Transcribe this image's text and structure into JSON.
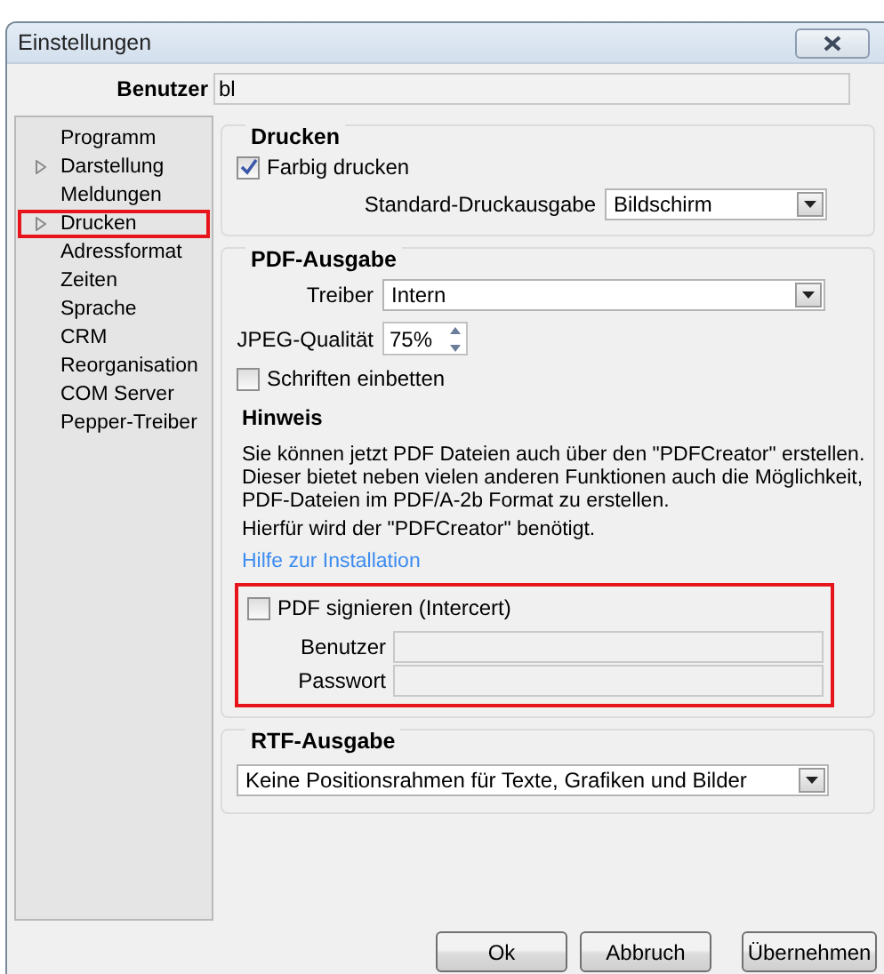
{
  "window": {
    "title": "Einstellungen"
  },
  "user": {
    "label": "Benutzer",
    "value": "bl"
  },
  "sidebar": {
    "items": [
      {
        "label": "Programm",
        "expandable": false,
        "selected": false
      },
      {
        "label": "Darstellung",
        "expandable": true,
        "selected": false
      },
      {
        "label": "Meldungen",
        "expandable": false,
        "selected": false
      },
      {
        "label": "Drucken",
        "expandable": true,
        "selected": true
      },
      {
        "label": "Adressformat",
        "expandable": false,
        "selected": false
      },
      {
        "label": "Zeiten",
        "expandable": false,
        "selected": false
      },
      {
        "label": "Sprache",
        "expandable": false,
        "selected": false
      },
      {
        "label": "CRM",
        "expandable": false,
        "selected": false
      },
      {
        "label": "Reorganisation",
        "expandable": false,
        "selected": false
      },
      {
        "label": "COM Server",
        "expandable": false,
        "selected": false
      },
      {
        "label": "Pepper-Treiber",
        "expandable": false,
        "selected": false
      }
    ]
  },
  "printing": {
    "title": "Drucken",
    "color_print": {
      "label": "Farbig drucken",
      "checked": true
    },
    "default_output": {
      "label": "Standard-Druckausgabe",
      "value": "Bildschirm"
    }
  },
  "pdf": {
    "title": "PDF-Ausgabe",
    "driver": {
      "label": "Treiber",
      "value": "Intern"
    },
    "jpeg_quality": {
      "label": "JPEG-Qualität",
      "value": "75%"
    },
    "embed_fonts": {
      "label": "Schriften einbetten",
      "checked": false
    },
    "note": {
      "title": "Hinweis",
      "lines": [
        "Sie können jetzt PDF Dateien auch über den \"PDFCreator\" erstellen.",
        "Dieser bietet neben vielen anderen Funktionen auch die Möglichkeit,",
        "PDF-Dateien im PDF/A-2b Format zu erstellen."
      ],
      "requirement": "Hierfür wird der \"PDFCreator\" benötigt.",
      "link": "Hilfe zur Installation"
    },
    "signing": {
      "label": "PDF signieren (Intercert)",
      "checked": false,
      "highlighted": true,
      "fields": [
        {
          "label": "Benutzer",
          "disabled": true
        },
        {
          "label": "Passwort",
          "disabled": true
        }
      ]
    }
  },
  "rtf": {
    "title": "RTF-Ausgabe",
    "value": "Keine Positionsrahmen für Texte, Grafiken und Bilder"
  },
  "buttons": [
    {
      "label": "Ok"
    },
    {
      "label": "Abbruch"
    },
    {
      "label": "Übernehmen"
    }
  ]
}
